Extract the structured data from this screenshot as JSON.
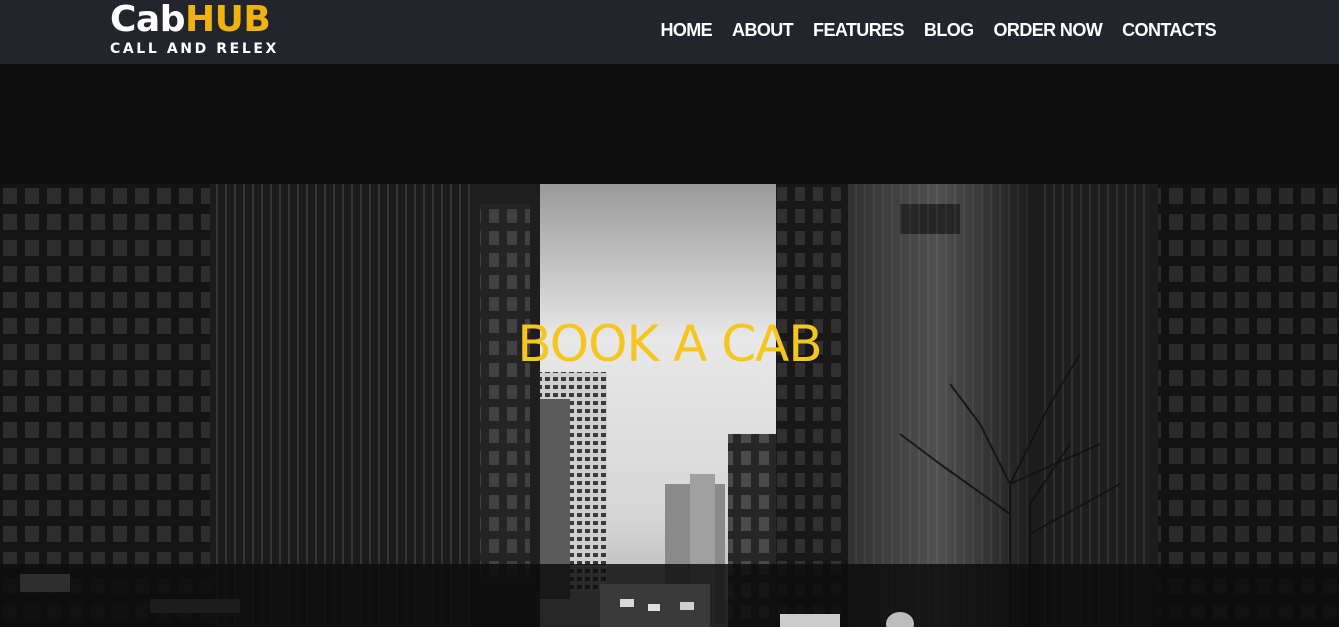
{
  "brand": {
    "name_part1": "Cab",
    "name_part2": "HUB",
    "tagline": "CALL AND RELEX",
    "accent_color": "#f0b20e"
  },
  "nav": {
    "items": [
      {
        "label": "HOME"
      },
      {
        "label": "ABOUT"
      },
      {
        "label": "FEATURES"
      },
      {
        "label": "BLOG"
      },
      {
        "label": "ORDER NOW"
      },
      {
        "label": "CONTACTS"
      }
    ]
  },
  "hero": {
    "title": "BOOK A CAB",
    "title_color": "#f6c51e",
    "image": "city-street-grayscale"
  }
}
